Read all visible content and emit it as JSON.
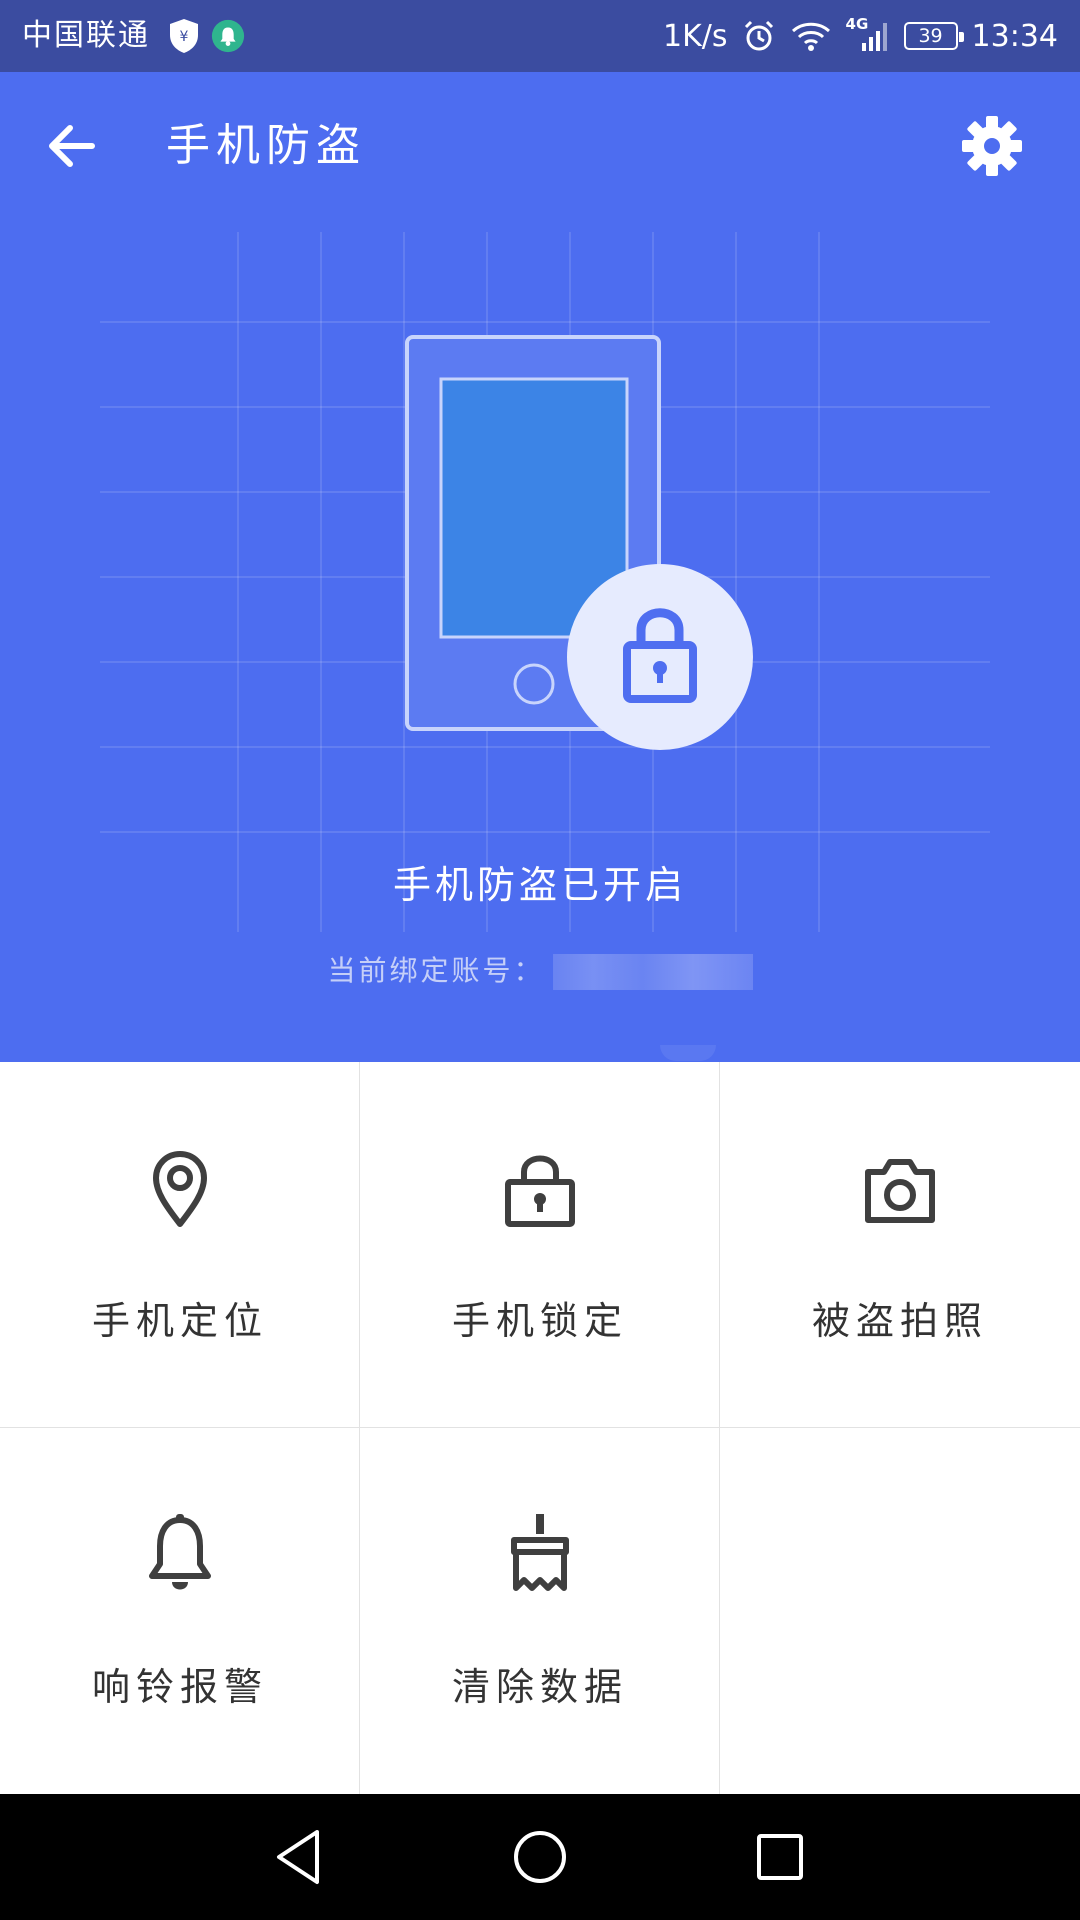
{
  "status_bar": {
    "carrier": "中国联通",
    "net_speed": "1K/s",
    "network_type": "4G",
    "battery": "39",
    "time": "13:34",
    "icons": [
      "shield-yen-icon",
      "bell-badge-icon",
      "alarm-icon",
      "wifi-icon",
      "signal-icon",
      "battery-icon"
    ]
  },
  "header": {
    "title": "手机防盗",
    "back_icon": "arrow-left-icon",
    "settings_icon": "gear-icon"
  },
  "hero": {
    "status_text": "手机防盗已开启",
    "account_label": "当前绑定账号："
  },
  "features": [
    {
      "label": "手机定位",
      "icon": "location-pin-icon"
    },
    {
      "label": "手机锁定",
      "icon": "lock-icon"
    },
    {
      "label": "被盗拍照",
      "icon": "camera-icon"
    },
    {
      "label": "响铃报警",
      "icon": "bell-icon"
    },
    {
      "label": "清除数据",
      "icon": "brush-icon"
    }
  ],
  "nav": {
    "icons": [
      "back-triangle-icon",
      "home-circle-icon",
      "recents-square-icon"
    ]
  },
  "colors": {
    "status_bar": "#3B4CA0",
    "hero_bg": "#4D6DF0",
    "icon_dark": "#3F3F3F"
  }
}
